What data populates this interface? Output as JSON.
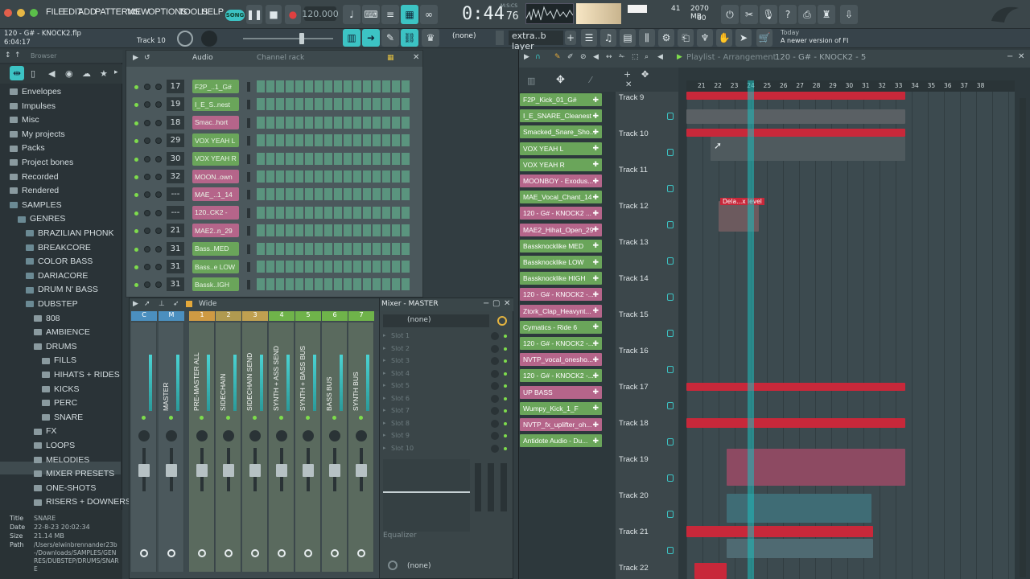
{
  "topbar": {
    "menu": [
      "FILE",
      "EDIT",
      "ADD",
      "PATTERNS",
      "VIEW",
      "OPTIONS",
      "TOOLS",
      "HELP"
    ],
    "song_mode": "SONG",
    "tempo": "120.000",
    "time_main": "0:44",
    "time_sub": "76",
    "time_unit": "M:S:CS",
    "cpu_value": "41",
    "memory": "2070 MB",
    "polyphony": "60"
  },
  "hintbar": {
    "project_file": "120 - G# - KNOCK2.flp",
    "position": "6:04:17",
    "track_hint": "Track 10",
    "snap_value": "(none)",
    "layer_label": "extra..b layer",
    "news_label": "Today",
    "news_text": "A newer version of FL Studio i..."
  },
  "browser": {
    "title": "Browser",
    "items": [
      {
        "label": "Envelopes",
        "level": 0
      },
      {
        "label": "Impulses",
        "level": 0
      },
      {
        "label": "Misc",
        "level": 0
      },
      {
        "label": "My projects",
        "level": 0
      },
      {
        "label": "Packs",
        "level": 0
      },
      {
        "label": "Project bones",
        "level": 0
      },
      {
        "label": "Recorded",
        "level": 0
      },
      {
        "label": "Rendered",
        "level": 0
      },
      {
        "label": "SAMPLES",
        "level": 0
      },
      {
        "label": "GENRES",
        "level": 1
      },
      {
        "label": "BRAZILIAN PHONK",
        "level": 2
      },
      {
        "label": "BREAKCORE",
        "level": 2
      },
      {
        "label": "COLOR BASS",
        "level": 2
      },
      {
        "label": "DARIACORE",
        "level": 2
      },
      {
        "label": "DRUM N' BASS",
        "level": 2
      },
      {
        "label": "DUBSTEP",
        "level": 2
      },
      {
        "label": "808",
        "level": 3
      },
      {
        "label": "AMBIENCE",
        "level": 3
      },
      {
        "label": "DRUMS",
        "level": 3
      },
      {
        "label": "FILLS",
        "level": 4
      },
      {
        "label": "HIHATS + RIDES",
        "level": 4
      },
      {
        "label": "KICKS",
        "level": 4
      },
      {
        "label": "PERC",
        "level": 4
      },
      {
        "label": "SNARE",
        "level": 4
      },
      {
        "label": "FX",
        "level": 3
      },
      {
        "label": "LOOPS",
        "level": 3
      },
      {
        "label": "MELODIES",
        "level": 3
      },
      {
        "label": "MIXER PRESETS",
        "level": 3
      },
      {
        "label": "ONE-SHOTS",
        "level": 3
      },
      {
        "label": "RISERS + DOWNERS",
        "level": 3
      }
    ],
    "info": {
      "title_key": "Title",
      "title_val": "SNARE",
      "date_key": "Date",
      "date_val": "22-8-23 20:02:34",
      "size_key": "Size",
      "size_val": "21.14 MB",
      "path_key": "Path",
      "path_val": "/Users/elwinbrennander23b-/Downloads/SAMPLES/GENRES/DUBSTEP/DRUMS/SNARE"
    }
  },
  "channel_rack": {
    "filter": "Audio",
    "title": "Channel rack",
    "channels": [
      {
        "num": "17",
        "name": "F2P_..1_G#",
        "color": "#6aa55a"
      },
      {
        "num": "19",
        "name": "I_E_S..nest",
        "color": "#6aa55a"
      },
      {
        "num": "18",
        "name": "Smac..hort",
        "color": "#b5658a"
      },
      {
        "num": "29",
        "name": "VOX YEAH L",
        "color": "#6aa55a"
      },
      {
        "num": "30",
        "name": "VOX YEAH R",
        "color": "#6aa55a"
      },
      {
        "num": "32",
        "name": "MOON..own",
        "color": "#b5658a"
      },
      {
        "num": "---",
        "name": "MAE_..1_14",
        "color": "#b5658a"
      },
      {
        "num": "---",
        "name": "120..CK2 -",
        "color": "#b5658a"
      },
      {
        "num": "21",
        "name": "MAE2..n_29",
        "color": "#b5658a"
      },
      {
        "num": "31",
        "name": "Bass..MED",
        "color": "#6aa55a"
      },
      {
        "num": "31",
        "name": "Bass..e LOW",
        "color": "#6aa55a"
      },
      {
        "num": "31",
        "name": "Bassk..IGH",
        "color": "#6aa55a"
      }
    ]
  },
  "mixer": {
    "view": "Wide",
    "title": "Mixer - MASTER",
    "strips": [
      {
        "num": "C",
        "label": "",
        "color": "#4b8fbf"
      },
      {
        "num": "M",
        "label": "MASTER",
        "color": "#4b8fbf"
      },
      {
        "num": "1",
        "label": "PRE-MASTER ALL",
        "color": "#cf9a43"
      },
      {
        "num": "2",
        "label": "SIDECHAIN",
        "color": "#b09a50"
      },
      {
        "num": "3",
        "label": "SIDECHAIN SEND",
        "color": "#c0a050"
      },
      {
        "num": "4",
        "label": "SYNTH + ASS SEND",
        "color": "#6fb34a"
      },
      {
        "num": "5",
        "label": "SYNTH + BASS BUS",
        "color": "#6fb34a"
      },
      {
        "num": "6",
        "label": "BASS BUS",
        "color": "#6fb34a"
      },
      {
        "num": "7",
        "label": "SYNTH BUS",
        "color": "#6fb34a"
      }
    ],
    "master_panel": {
      "preset": "(none)",
      "slots": [
        "Slot 1",
        "Slot 2",
        "Slot 3",
        "Slot 4",
        "Slot 5",
        "Slot 6",
        "Slot 7",
        "Slot 8",
        "Slot 9",
        "Slot 10"
      ],
      "eq_label": "Equalizer",
      "bottom_preset": "(none)"
    }
  },
  "patterns": [
    {
      "name": "F2P_Kick_01_G#",
      "color": "#6aa55a"
    },
    {
      "name": "I_E_SNARE_Cleanest",
      "color": "#6aa55a"
    },
    {
      "name": "Smacked_Snare_Sho...",
      "color": "#6aa55a"
    },
    {
      "name": "VOX YEAH L",
      "color": "#6aa55a"
    },
    {
      "name": "VOX YEAH R",
      "color": "#6aa55a"
    },
    {
      "name": "MOONBOY - Exodus...",
      "color": "#b5658a"
    },
    {
      "name": "MAE_Vocal_Chant_14",
      "color": "#6aa55a"
    },
    {
      "name": "120 - G# - KNOCK2 ...",
      "color": "#b5658a"
    },
    {
      "name": "MAE2_Hihat_Open_29",
      "color": "#b5658a"
    },
    {
      "name": "Bassknocklike MED",
      "color": "#6aa55a"
    },
    {
      "name": "Bassknocklike LOW",
      "color": "#6aa55a"
    },
    {
      "name": "Bassknocklike HIGH",
      "color": "#6aa55a"
    },
    {
      "name": "120 - G# - KNOCK2 -...",
      "color": "#b5658a"
    },
    {
      "name": "Ztork_Clap_Heavynt...",
      "color": "#b5658a"
    },
    {
      "name": "Cymatics - Ride 6",
      "color": "#6aa55a"
    },
    {
      "name": "120 - G# - KNOCK2 -...",
      "color": "#6aa55a"
    },
    {
      "name": "NVTP_vocal_onesho...",
      "color": "#b5658a"
    },
    {
      "name": "120 - G# - KNOCK2 -...",
      "color": "#6aa55a"
    },
    {
      "name": "UP BASS",
      "color": "#b5658a"
    },
    {
      "name": "Wumpy_Kick_1_F",
      "color": "#6aa55a"
    },
    {
      "name": "NVTP_fx_uplifter_oh...",
      "color": "#b5658a"
    },
    {
      "name": "Antidote Audio - Du...",
      "color": "#6aa55a"
    }
  ],
  "playlist": {
    "title": "Playlist - Arrangement",
    "pattern_crumb": "120 - G# - KNOCK2 - 5",
    "ruler": [
      "21",
      "22",
      "23",
      "24",
      "25",
      "26",
      "27",
      "28",
      "29",
      "30",
      "31",
      "32",
      "33",
      "34",
      "35",
      "36",
      "37",
      "38"
    ],
    "tracks": [
      "Track 9",
      "Track 10",
      "Track 11",
      "Track 12",
      "Track 13",
      "Track 14",
      "Track 15",
      "Track 16",
      "Track 17",
      "Track 18",
      "Track 19",
      "Track 20",
      "Track 21",
      "Track 22"
    ],
    "automation_clip": "Dela...x level"
  },
  "colors": {
    "accent": "#3cc3c4",
    "clip_red": "#c8283a",
    "clip_pink": "#b5658a",
    "clip_green": "#6aa55a"
  }
}
